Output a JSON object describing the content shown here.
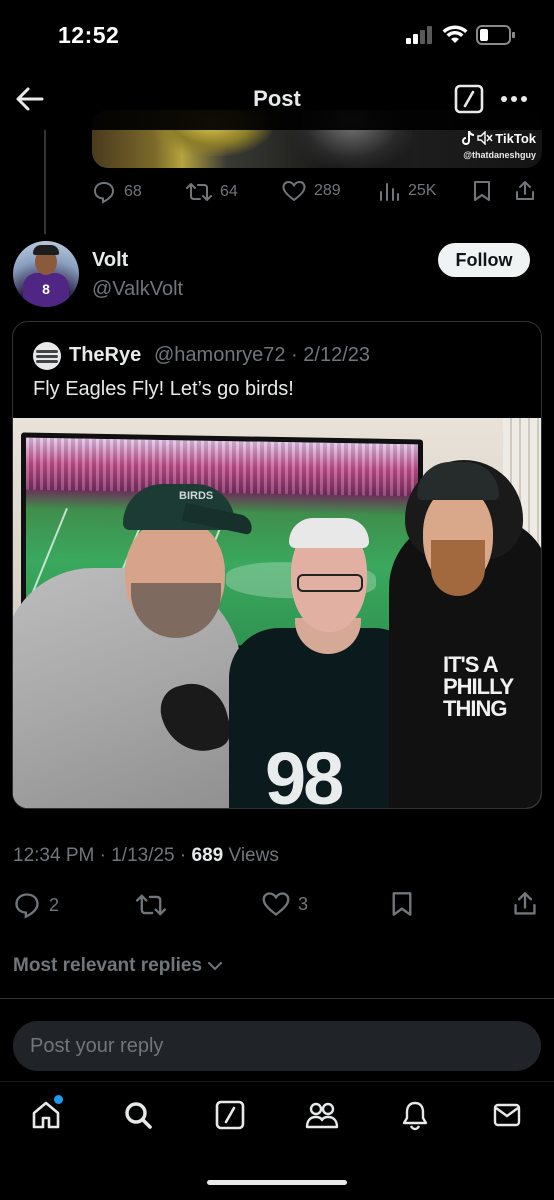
{
  "status_bar": {
    "time": "12:52"
  },
  "header": {
    "title": "Post"
  },
  "previous_post": {
    "tiktok_label": "TikTok",
    "tiktok_handle": "@thatdaneshguy",
    "replies": "68",
    "reposts": "64",
    "likes": "289",
    "views": "25K"
  },
  "post": {
    "author_name": "Volt",
    "author_handle": "@ValkVolt",
    "follow_label": "Follow",
    "quoted": {
      "name": "TheRye",
      "handle": "@hamonrye72",
      "date": "2/12/23",
      "separator": "·",
      "text": "Fly Eagles Fly! Let’s go birds!",
      "photo": {
        "cap_text": "BIRDS",
        "jersey_number": "98",
        "shirt_lines": [
          "IT'S A",
          "PHILLY",
          "THING"
        ]
      }
    },
    "time": "12:34 PM",
    "date": "1/13/25",
    "views_count": "689",
    "views_label": "Views",
    "replies": "2",
    "likes": "3"
  },
  "replies_sort": {
    "label": "Most relevant replies"
  },
  "reply_input": {
    "placeholder": "Post your reply"
  },
  "colors": {
    "accent": "#1d9bf0",
    "muted": "#71767b",
    "text": "#e7e9ea",
    "background": "#000000"
  },
  "icons": {
    "tabs": [
      "home-icon",
      "search-icon",
      "grok-icon",
      "communities-icon",
      "notifications-icon",
      "messages-icon"
    ]
  }
}
